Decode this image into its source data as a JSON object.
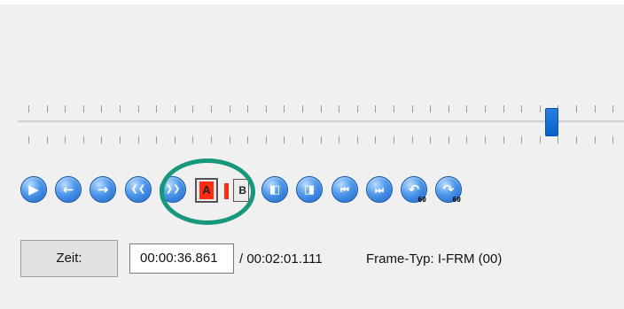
{
  "timeline": {
    "position_fraction": 0.88
  },
  "controls": {
    "buttons": [
      {
        "name": "play-icon",
        "glyph": "▶"
      },
      {
        "name": "prev-frame-icon",
        "glyph": "←"
      },
      {
        "name": "next-frame-icon",
        "glyph": "→"
      },
      {
        "name": "rewind-icon",
        "glyph": "❮❮"
      },
      {
        "name": "fast-forward-icon",
        "glyph": "❯❯"
      }
    ],
    "mark_a_label": "A",
    "mark_b_label": "B",
    "nav_buttons": [
      {
        "name": "goto-start-marker-icon",
        "glyph": "◧"
      },
      {
        "name": "goto-end-marker-icon",
        "glyph": "◨"
      },
      {
        "name": "prev-keyframe-icon",
        "glyph": "⏮"
      },
      {
        "name": "next-keyframe-icon",
        "glyph": "⏭"
      },
      {
        "name": "back-60-icon",
        "glyph": "↶",
        "sub": "60"
      },
      {
        "name": "forward-60-icon",
        "glyph": "↷",
        "sub": "60"
      }
    ]
  },
  "status": {
    "zeit_button": "Zeit:",
    "current_time": "00:00:36.861",
    "total_time": "/ 00:02:01.111",
    "frame_type": "Frame-Typ:  I-FRM (00)"
  }
}
